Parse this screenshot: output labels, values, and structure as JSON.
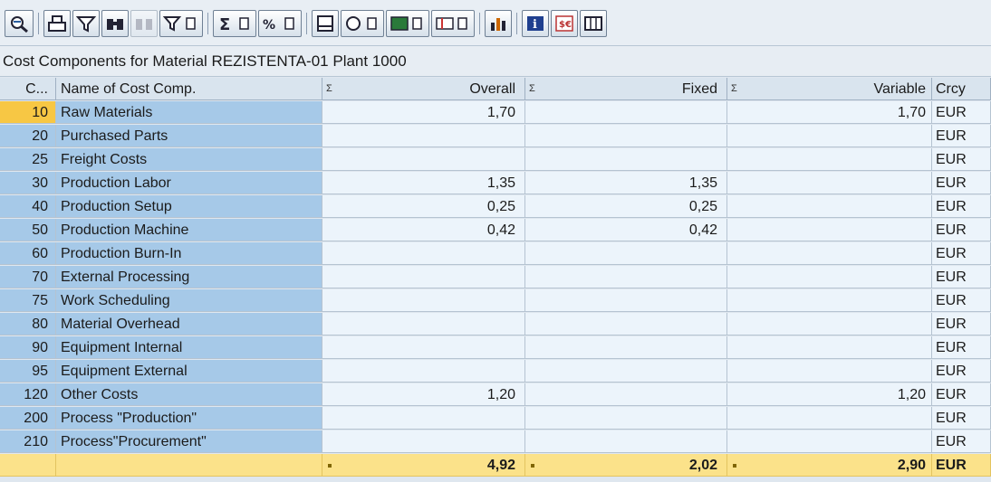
{
  "window": {
    "title": "Cost Components for Material REZISTENTA-01 Plant 1000"
  },
  "toolbar": {
    "buttons": [
      {
        "icon": "details-icon"
      },
      {
        "icon": "print-icon"
      },
      {
        "icon": "filter-funnel-icon"
      },
      {
        "icon": "find-binoculars-icon"
      },
      {
        "icon": "find-next-icon"
      },
      {
        "icon": "set-filter-icon"
      },
      {
        "icon": "total-sigma-icon"
      },
      {
        "icon": "subtotal-icon"
      },
      {
        "icon": "print-preview-icon"
      },
      {
        "icon": "export-icon"
      },
      {
        "icon": "spreadsheet-icon"
      },
      {
        "icon": "change-layout-icon"
      },
      {
        "icon": "graphic-icon"
      },
      {
        "icon": "information-icon"
      },
      {
        "icon": "currency-icon"
      },
      {
        "icon": "table-view-icon"
      }
    ]
  },
  "table": {
    "columns": {
      "code": "C...",
      "name": "Name of Cost Comp.",
      "overall": "Overall",
      "fixed": "Fixed",
      "variable": "Variable",
      "currency": "Crcy"
    },
    "rows": [
      {
        "code": "10",
        "name": "Raw Materials",
        "overall": "1,70",
        "fixed": "",
        "variable": "1,70",
        "crcy": "EUR"
      },
      {
        "code": "20",
        "name": "Purchased Parts",
        "overall": "",
        "fixed": "",
        "variable": "",
        "crcy": "EUR"
      },
      {
        "code": "25",
        "name": "Freight Costs",
        "overall": "",
        "fixed": "",
        "variable": "",
        "crcy": "EUR"
      },
      {
        "code": "30",
        "name": "Production Labor",
        "overall": "1,35",
        "fixed": "1,35",
        "variable": "",
        "crcy": "EUR"
      },
      {
        "code": "40",
        "name": "Production Setup",
        "overall": "0,25",
        "fixed": "0,25",
        "variable": "",
        "crcy": "EUR"
      },
      {
        "code": "50",
        "name": "Production Machine",
        "overall": "0,42",
        "fixed": "0,42",
        "variable": "",
        "crcy": "EUR"
      },
      {
        "code": "60",
        "name": "Production Burn-In",
        "overall": "",
        "fixed": "",
        "variable": "",
        "crcy": "EUR"
      },
      {
        "code": "70",
        "name": "External Processing",
        "overall": "",
        "fixed": "",
        "variable": "",
        "crcy": "EUR"
      },
      {
        "code": "75",
        "name": "Work Scheduling",
        "overall": "",
        "fixed": "",
        "variable": "",
        "crcy": "EUR"
      },
      {
        "code": "80",
        "name": "Material Overhead",
        "overall": "",
        "fixed": "",
        "variable": "",
        "crcy": "EUR"
      },
      {
        "code": "90",
        "name": "Equipment Internal",
        "overall": "",
        "fixed": "",
        "variable": "",
        "crcy": "EUR"
      },
      {
        "code": "95",
        "name": "Equipment External",
        "overall": "",
        "fixed": "",
        "variable": "",
        "crcy": "EUR"
      },
      {
        "code": "120",
        "name": "Other Costs",
        "overall": "1,20",
        "fixed": "",
        "variable": "1,20",
        "crcy": "EUR"
      },
      {
        "code": "200",
        "name": "Process \"Production\"",
        "overall": "",
        "fixed": "",
        "variable": "",
        "crcy": "EUR"
      },
      {
        "code": "210",
        "name": "Process\"Procurement\"",
        "overall": "",
        "fixed": "",
        "variable": "",
        "crcy": "EUR"
      }
    ],
    "totals": {
      "overall": "4,92",
      "fixed": "2,02",
      "variable": "2,90",
      "crcy": "EUR"
    },
    "sigma_marker": "Σ",
    "selected_code": "10"
  },
  "colors": {
    "key_column": "#a6c9e8",
    "value_cells": "#ecf4fb",
    "selected": "#f7c744",
    "total_row": "#fbe28a"
  }
}
